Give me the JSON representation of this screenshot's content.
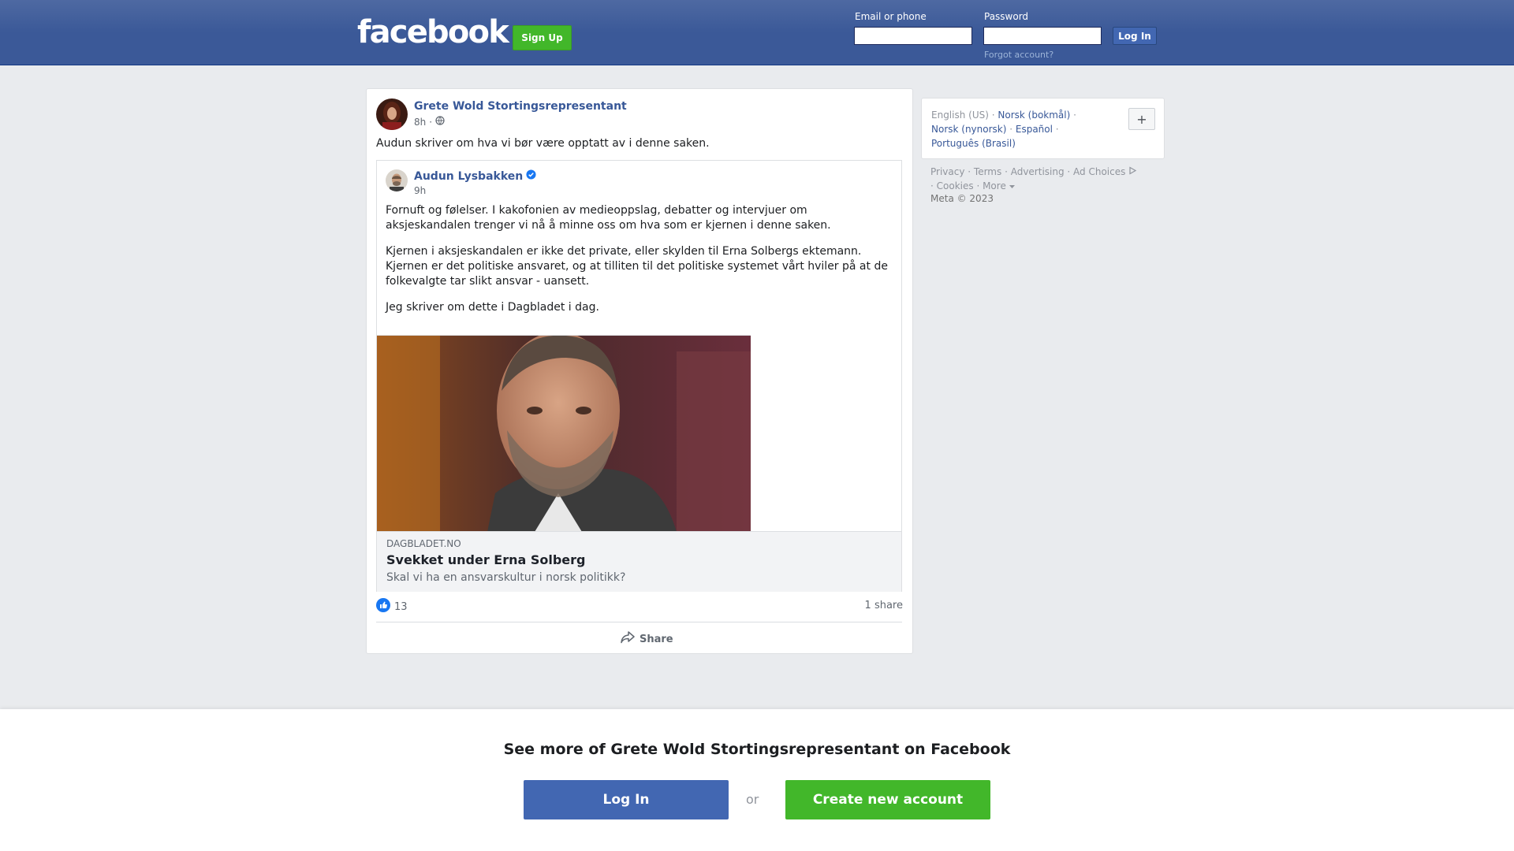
{
  "header": {
    "logo": "facebook",
    "signup_label": "Sign Up",
    "email_label": "Email or phone",
    "password_label": "Password",
    "login_label": "Log In",
    "forgot_label": "Forgot account?"
  },
  "post": {
    "author": "Grete Wold Stortingsrepresentant",
    "time": "8h",
    "privacy_icon": "globe-icon",
    "text": "Audun skriver om hva vi bør være opptatt av i denne saken.",
    "shared": {
      "author": "Audun Lysbakken",
      "verified_icon": "verified-badge-icon",
      "time": "9h",
      "paragraphs": [
        "Fornuft og følelser. I kakofonien av medieoppslag, debatter og intervjuer om aksjeskandalen trenger vi nå å minne oss om hva som er kjernen i denne saken.",
        "Kjernen i aksjeskandalen er ikke det private, eller skylden til Erna Solbergs ektemann. Kjernen er det politiske ansvaret, og at tilliten til det politiske systemet vårt hviler på at de folkevalgte tar slikt ansvar - uansett.",
        "Jeg skriver om dette i Dagbladet i dag."
      ],
      "link": {
        "domain": "DAGBLADET.NO",
        "title": "Svekket under Erna Solberg",
        "description": "Skal vi ha en ansvarskultur i norsk politikk?"
      }
    },
    "reaction_icon": "like-icon",
    "reaction_count": "13",
    "shares": "1 share",
    "share_label": "Share"
  },
  "sidebar": {
    "languages": {
      "current": "English (US)",
      "others": [
        "Norsk (bokmål)",
        "Norsk (nynorsk)",
        "Español",
        "Português (Brasil)"
      ],
      "add_label": "+"
    },
    "footer_links": [
      "Privacy",
      "Terms",
      "Advertising",
      "Ad Choices",
      "Cookies",
      "More"
    ],
    "copyright": "Meta © 2023"
  },
  "banner": {
    "title": "See more of Grete Wold Stortingsrepresentant on Facebook",
    "login_label": "Log In",
    "or_label": "or",
    "create_label": "Create new account"
  },
  "colors": {
    "header_blue": "#3b5998",
    "link_blue": "#385898",
    "button_blue": "#4267b2",
    "green": "#42b72a",
    "page_bg": "#e9ebee"
  }
}
